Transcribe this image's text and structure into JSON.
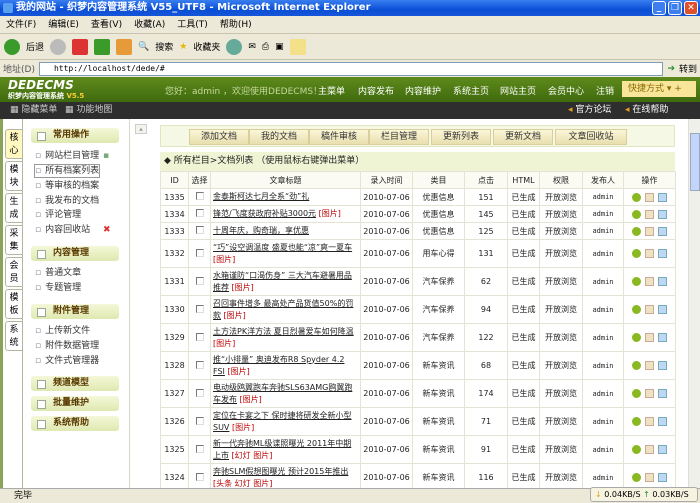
{
  "window": {
    "title": "我的网站 - 织梦内容管理系统 V55_UTF8 - Microsoft Internet Explorer"
  },
  "menubar": [
    "文件(F)",
    "编辑(E)",
    "查看(V)",
    "收藏(A)",
    "工具(T)",
    "帮助(H)"
  ],
  "toolbar": {
    "back": "后退",
    "search": "搜索",
    "favorites": "收藏夹"
  },
  "address": {
    "label": "地址(D)",
    "url": "http://localhost/dede/#",
    "go": "转到"
  },
  "header": {
    "logo": "DEDECMS",
    "logo_sub": "织梦内容管理系统",
    "version": "V5.5",
    "greeting": "您好：admin ，欢迎使用DEDECMS！",
    "nav": [
      "主菜单",
      "内容发布",
      "内容维护",
      "系统主页",
      "网站主页",
      "会员中心",
      "注销"
    ],
    "quick": "快捷方式"
  },
  "subbar": {
    "hide_menu": "隐藏菜单",
    "function_map": "功能地图",
    "forum": "官方论坛",
    "help": "在线帮助"
  },
  "vtabs": [
    "核心",
    "模块",
    "生成",
    "采集",
    "会员",
    "模板",
    "系统"
  ],
  "sidebar": {
    "groups": [
      {
        "title": "常用操作",
        "items": [
          "网站栏目管理",
          "所有档案列表",
          "等审核的档案",
          "我发布的文档",
          "评论管理",
          "内容回收站"
        ]
      },
      {
        "title": "内容管理",
        "items": [
          "普通文章",
          "专题管理"
        ]
      },
      {
        "title": "附件管理",
        "items": [
          "上传新文件",
          "附件数据管理",
          "文件式管理器"
        ]
      },
      {
        "title": "频道模型",
        "items": []
      },
      {
        "title": "批量维护",
        "items": []
      },
      {
        "title": "系统帮助",
        "items": []
      }
    ]
  },
  "buttons": [
    "添加文档",
    "我的文档",
    "稿件审核",
    "栏目管理",
    "更新列表",
    "更新文档",
    "文章回收站"
  ],
  "breadcrumb": "所有栏目>文档列表  （使用鼠标右键弹出菜单）",
  "table": {
    "headers": [
      "ID",
      "选择",
      "文章标题",
      "录入时间",
      "类目",
      "点击",
      "HTML",
      "权限",
      "发布人",
      "操作"
    ],
    "rows": [
      {
        "id": "1335",
        "title": "金泰斯柯达七月全系“劲”礼",
        "tags": "",
        "date": "2010-07-06",
        "cat": "优惠信息",
        "clicks": "151",
        "html": "已生成",
        "perm": "开放浏览",
        "author": "admin"
      },
      {
        "id": "1334",
        "title": "锋范/飞度获政府补贴3000元",
        "tags": "[图片]",
        "date": "2010-07-06",
        "cat": "优惠信息",
        "clicks": "145",
        "html": "已生成",
        "perm": "开放浏览",
        "author": "admin"
      },
      {
        "id": "1333",
        "title": "十周年庆，购奇瑞，享优惠",
        "tags": "",
        "date": "2010-07-06",
        "cat": "优惠信息",
        "clicks": "125",
        "html": "已生成",
        "perm": "开放浏览",
        "author": "admin"
      },
      {
        "id": "1332",
        "title": "“巧”设空调温度 盛夏也能“凉”爽一夏车",
        "tags": "[图片]",
        "date": "2010-07-06",
        "cat": "用车心得",
        "clicks": "131",
        "html": "已生成",
        "perm": "开放浏览",
        "author": "admin"
      },
      {
        "id": "1331",
        "title": "水箱谨防“口渴伤身” 三大汽车避暑用品推荐",
        "tags": "[图片]",
        "date": "2010-07-06",
        "cat": "汽车保养",
        "clicks": "62",
        "html": "已生成",
        "perm": "开放浏览",
        "author": "admin"
      },
      {
        "id": "1330",
        "title": "召回事件增多 最高处产品货值50%的罚款",
        "tags": "[图片]",
        "date": "2010-07-06",
        "cat": "汽车保养",
        "clicks": "94",
        "html": "已生成",
        "perm": "开放浏览",
        "author": "admin"
      },
      {
        "id": "1329",
        "title": "土方法PK洋方法 夏日烈暑爱车如何降温",
        "tags": "[图片]",
        "date": "2010-07-06",
        "cat": "汽车保养",
        "clicks": "122",
        "html": "已生成",
        "perm": "开放浏览",
        "author": "admin"
      },
      {
        "id": "1328",
        "title": "推“小排量” 奥迪发布R8 Spyder 4.2 FSI",
        "tags": "[图片]",
        "date": "2010-07-06",
        "cat": "新车资讯",
        "clicks": "68",
        "html": "已生成",
        "perm": "开放浏览",
        "author": "admin"
      },
      {
        "id": "1327",
        "title": "电动级鸥翼跑车奔驰SLS63AMG鸥翼跑车发布",
        "tags": "[图片]",
        "date": "2010-07-06",
        "cat": "新车资讯",
        "clicks": "174",
        "html": "已生成",
        "perm": "开放浏览",
        "author": "admin"
      },
      {
        "id": "1326",
        "title": "定位在卡宴之下 保时捷将研发全新小型SUV",
        "tags": "[图片]",
        "date": "2010-07-06",
        "cat": "新车资讯",
        "clicks": "71",
        "html": "已生成",
        "perm": "开放浏览",
        "author": "admin"
      },
      {
        "id": "1325",
        "title": "新一代奔驰ML级谍照曝光 2011年中期上市",
        "tags": "[幻灯 图片]",
        "date": "2010-07-06",
        "cat": "新车资讯",
        "clicks": "91",
        "html": "已生成",
        "perm": "开放浏览",
        "author": "admin"
      },
      {
        "id": "1324",
        "title": "奔驰SLM假想图曝光 预计2015年推出",
        "tags": "[头条 幻灯 图片]",
        "date": "2010-07-06",
        "cat": "新车资讯",
        "clicks": "116",
        "html": "已生成",
        "perm": "开放浏览",
        "author": "admin"
      }
    ]
  },
  "status": {
    "text": "完毕",
    "down": "0.04KB/S",
    "up": "0.03KB/S"
  }
}
